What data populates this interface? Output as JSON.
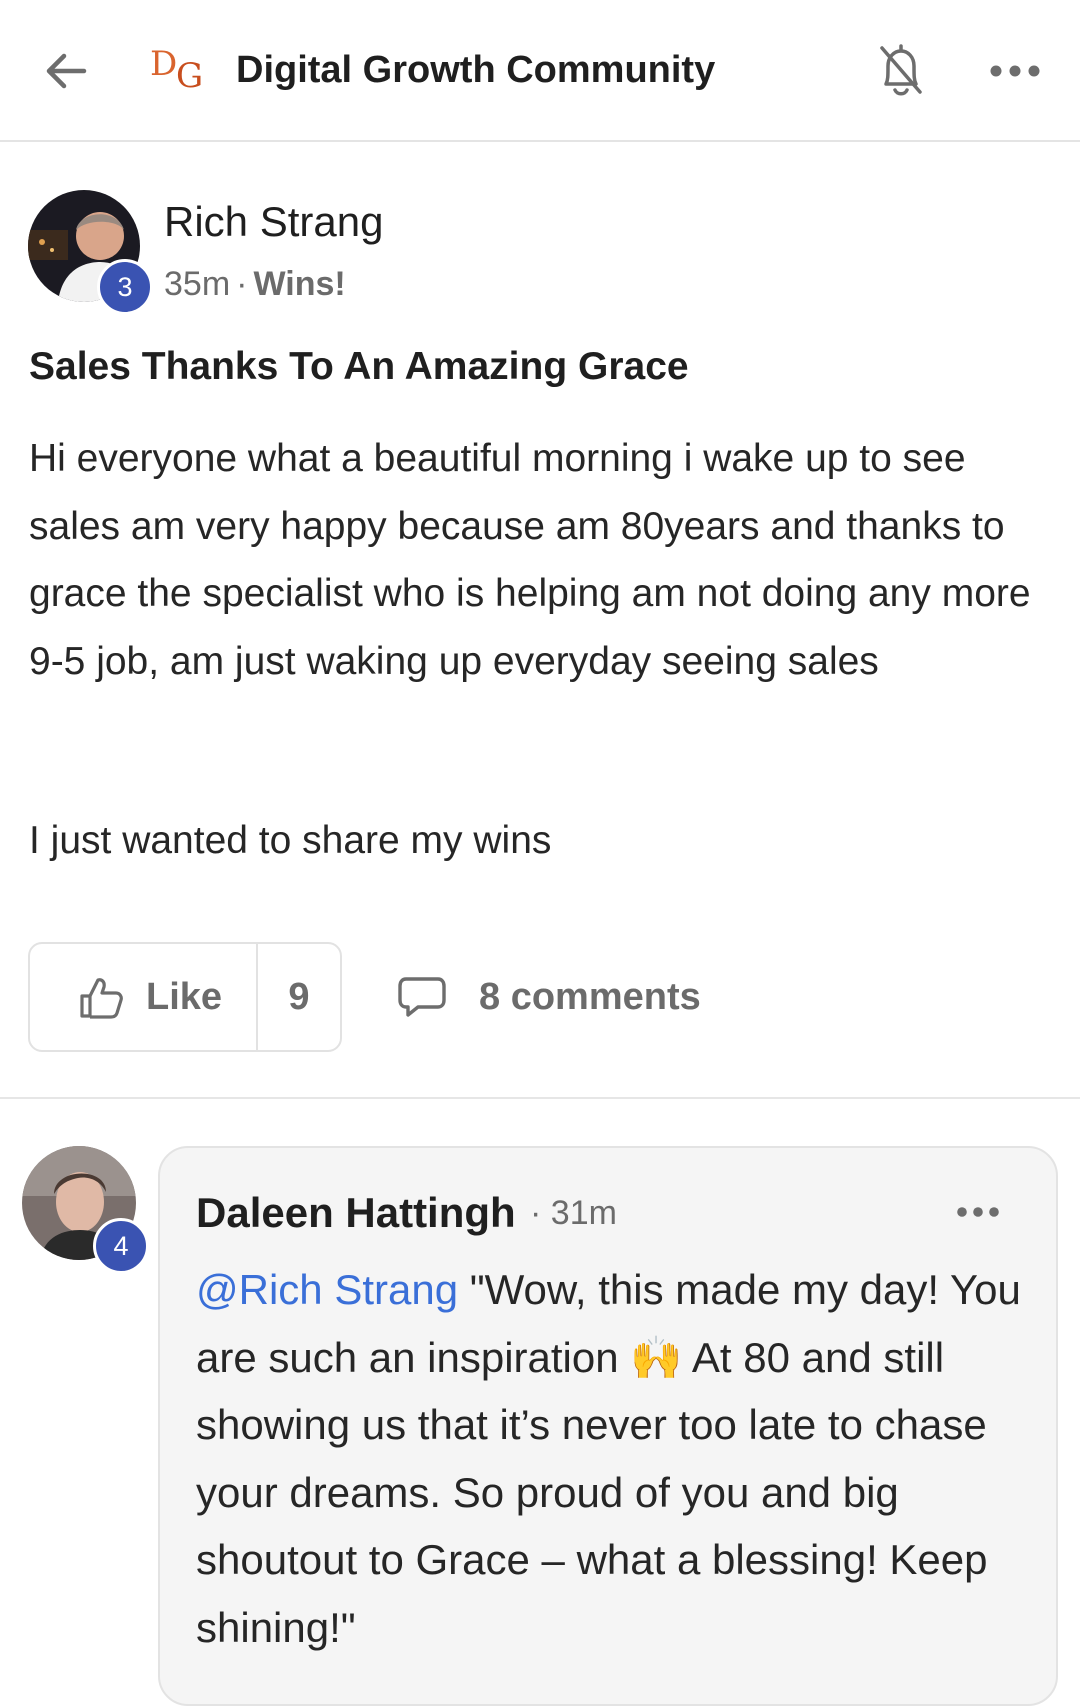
{
  "header": {
    "back_icon": "arrow-left-icon",
    "logo_text_d": "D",
    "logo_text_g": "G",
    "title": "Digital Growth Community",
    "bell_icon": "bell-off-icon",
    "more_icon": "more-horizontal-icon"
  },
  "post": {
    "author": "Rich Strang",
    "level": "3",
    "time": "35m",
    "category": "Wins!",
    "title": "Sales Thanks To An Amazing Grace",
    "body_paragraph_1": "Hi everyone what a beautiful morning i wake up to see sales am very happy because am 80years and thanks to grace the specialist who is helping am not doing any more 9-5 job, am just waking up everyday seeing sales",
    "body_paragraph_2": "I just wanted to share my wins",
    "like_label": "Like",
    "like_count": "9",
    "comments_label": "8 comments"
  },
  "comment": {
    "author": "Daleen Hattingh",
    "level": "4",
    "time": "31m",
    "mention": "@Rich Strang",
    "text_part_1": " \"Wow, this made my day! You are such an inspiration ",
    "emoji": "🙌",
    "text_part_2": " At 80 and still showing us that it’s never too late to chase your dreams. So proud of you and big shoutout to Grace – what a blessing! Keep shining!\""
  },
  "colors": {
    "accent_badge": "#3a53b2",
    "mention": "#3a6fd8",
    "muted_text": "#6b6b6b",
    "logo": "#d9642e"
  }
}
